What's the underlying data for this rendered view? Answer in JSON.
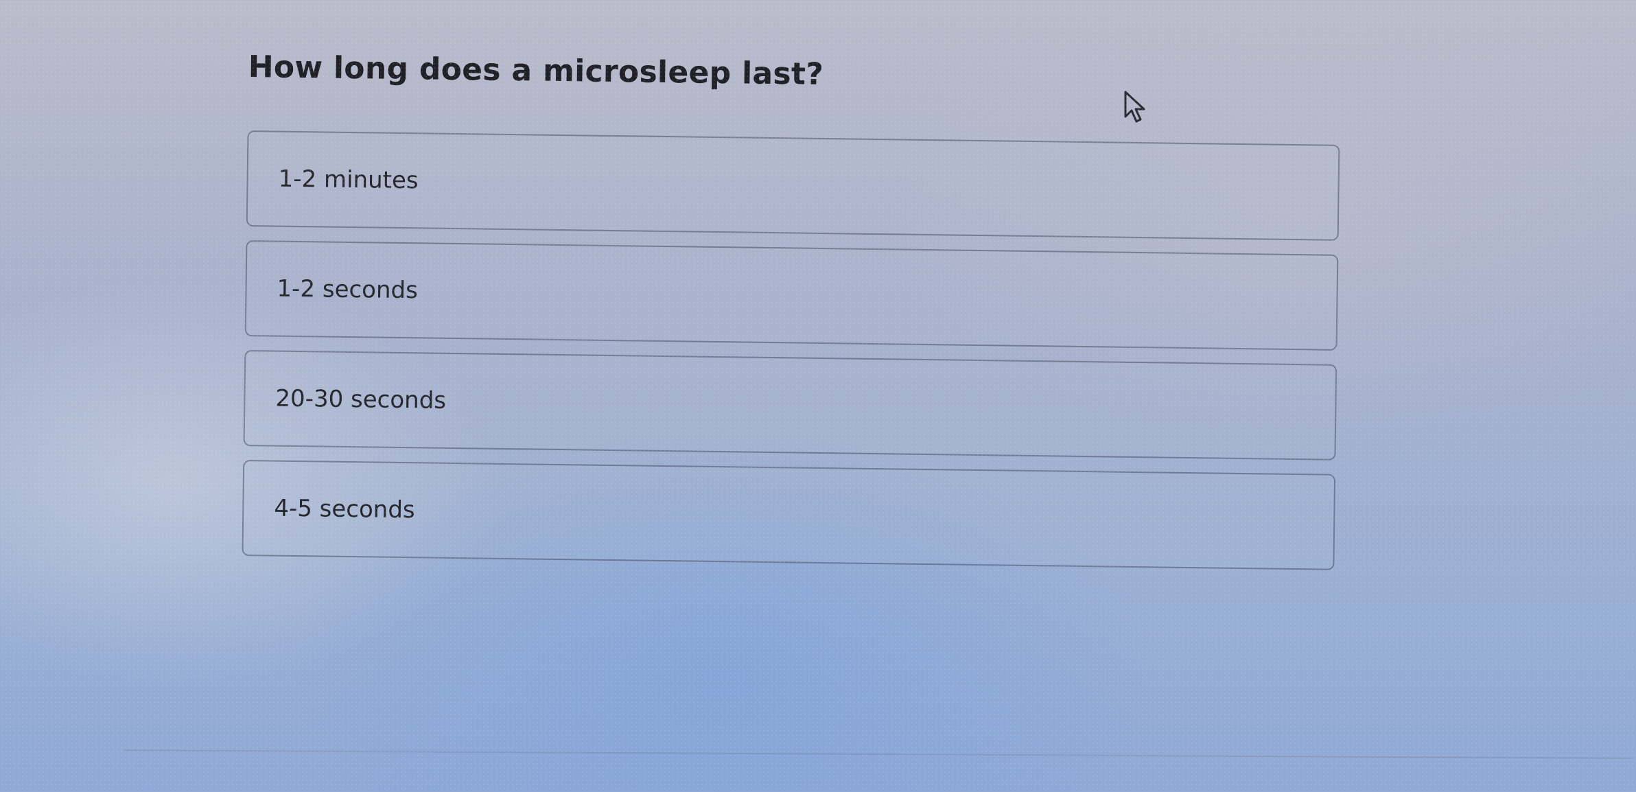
{
  "question": {
    "text": "How long does a microsleep last?"
  },
  "options": [
    {
      "label": "1-2 minutes"
    },
    {
      "label": "1-2 seconds"
    },
    {
      "label": "20-30 seconds"
    },
    {
      "label": "4-5 seconds"
    }
  ],
  "icons": {
    "cursor": "mouse-pointer-icon"
  }
}
